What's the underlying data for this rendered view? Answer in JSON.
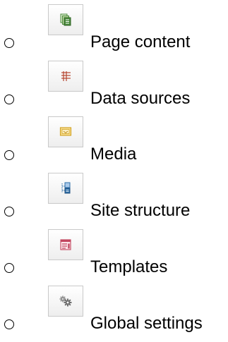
{
  "menu": {
    "items": [
      {
        "label": "Page content",
        "icon": "pages-icon",
        "color": "#4a8a3c"
      },
      {
        "label": "Data sources",
        "icon": "table-icon",
        "color": "#b5452f"
      },
      {
        "label": "Media",
        "icon": "image-icon",
        "color": "#d3a52a"
      },
      {
        "label": "Site structure",
        "icon": "tree-structure-icon",
        "color": "#2f6fa8"
      },
      {
        "label": "Templates",
        "icon": "template-icon",
        "color": "#c2455f"
      },
      {
        "label": "Global settings",
        "icon": "gears-icon",
        "color": "#8c8c8c"
      }
    ]
  }
}
